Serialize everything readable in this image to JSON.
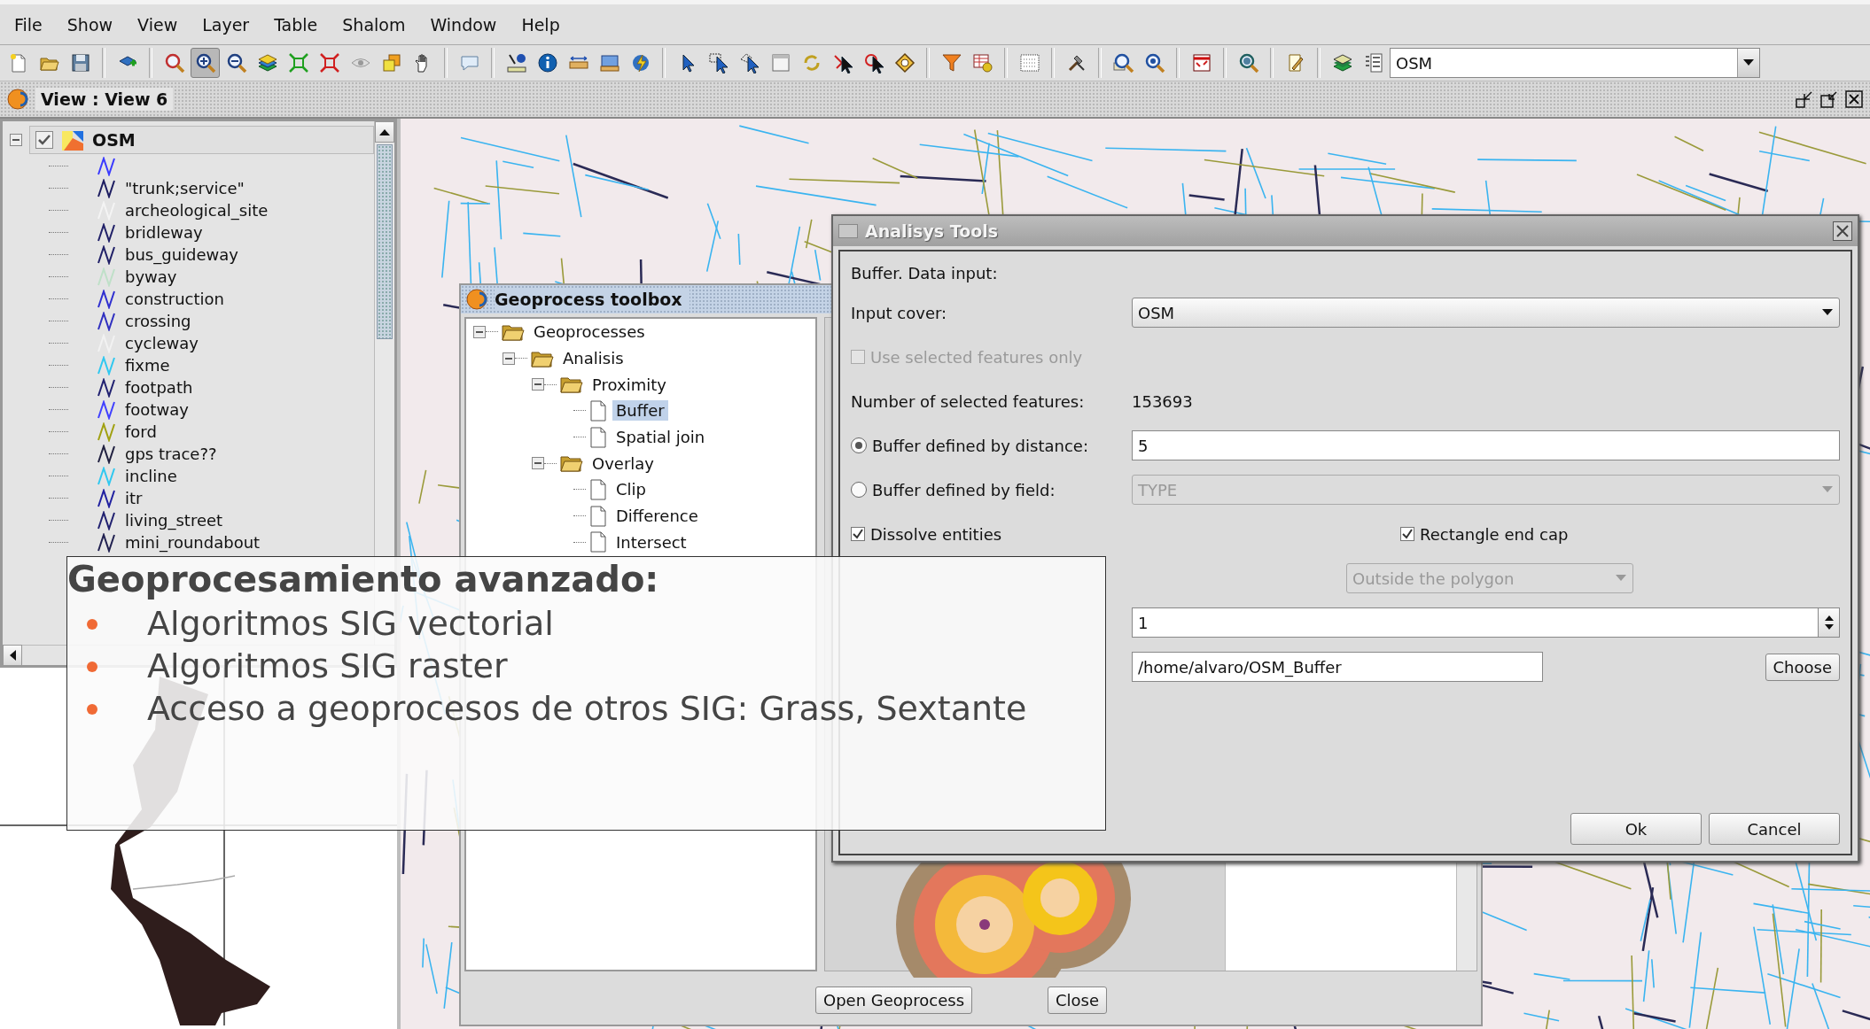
{
  "menu_bar": [
    "File",
    "Show",
    "View",
    "Layer",
    "Table",
    "Shalom",
    "Window",
    "Help"
  ],
  "toolbar": {
    "tools": [
      {
        "selected": false
      },
      {
        "selected": false
      },
      {
        "selected": false
      },
      {
        "selected": false
      },
      {
        "selected": false
      },
      {
        "selected": true
      },
      {
        "selected": false
      },
      {
        "selected": false
      },
      {
        "selected": false
      },
      {
        "selected": false
      },
      {
        "selected": false
      },
      {
        "selected": false
      },
      {
        "selected": false
      },
      {
        "selected": false
      },
      {
        "selected": false
      },
      {
        "selected": false
      },
      {
        "selected": false
      },
      {
        "selected": false
      },
      {
        "selected": false
      },
      {
        "selected": false
      },
      {
        "selected": false
      },
      {
        "selected": false
      },
      {
        "selected": false
      },
      {
        "selected": false
      },
      {
        "selected": false
      },
      {
        "selected": false
      },
      {
        "selected": false
      },
      {
        "selected": false
      },
      {
        "selected": false
      },
      {
        "selected": false
      },
      {
        "selected": false
      },
      {
        "selected": false
      },
      {
        "selected": false
      },
      {
        "selected": false
      },
      {
        "selected": false
      },
      {
        "selected": false
      },
      {
        "selected": false
      },
      {
        "selected": false
      }
    ],
    "layer_combo": "OSM"
  },
  "view_window": {
    "title": "View : View 6"
  },
  "layer_tree": {
    "root": {
      "label": "OSM",
      "checked": true,
      "expanded": true,
      "children": [
        {
          "color": "#3a3aff"
        },
        {
          "label": "\"trunk;service\"",
          "color": "#1c1c60"
        },
        {
          "label": "archeological_site",
          "color": "#f4f4f4"
        },
        {
          "label": "bridleway",
          "color": "#202068"
        },
        {
          "label": "bus_guideway",
          "color": "#202068"
        },
        {
          "label": "byway",
          "color": "#bfe0c8"
        },
        {
          "label": "construction",
          "color": "#2f2fd0"
        },
        {
          "label": "crossing",
          "color": "#2f2fc0"
        },
        {
          "label": "cycleway",
          "color": "#f2f2f2"
        },
        {
          "label": "fixme",
          "color": "#30c8f0"
        },
        {
          "label": "footpath",
          "color": "#202070"
        },
        {
          "label": "footway",
          "color": "#4040ff"
        },
        {
          "label": "ford",
          "color": "#a0a010"
        },
        {
          "label": "gps trace??",
          "color": "#202040"
        },
        {
          "label": "incline",
          "color": "#30c8f0"
        },
        {
          "label": "itr",
          "color": "#2020a0"
        },
        {
          "label": "living_street",
          "color": "#202070"
        },
        {
          "label": "mini_roundabout",
          "color": "#202050"
        }
      ]
    }
  },
  "geoprocess_toolbox": {
    "title": "Geoprocess toolbox",
    "tree": [
      {
        "label": "Geoprocesses",
        "kind": "folder",
        "expanded": true,
        "selected": false,
        "children": [
          {
            "label": "Analisis",
            "kind": "folder",
            "expanded": true,
            "selected": false,
            "children": [
              {
                "label": "Proximity",
                "kind": "folder",
                "expanded": true,
                "selected": false,
                "children": [
                  {
                    "label": "Buffer",
                    "kind": "file",
                    "selected": true
                  },
                  {
                    "label": "Spatial join",
                    "kind": "file",
                    "selected": false
                  }
                ]
              },
              {
                "label": "Overlay",
                "kind": "folder",
                "expanded": true,
                "selected": false,
                "children": [
                  {
                    "label": "Clip",
                    "kind": "file",
                    "selected": false
                  },
                  {
                    "label": "Difference",
                    "kind": "file",
                    "selected": false
                  },
                  {
                    "label": "Intersect",
                    "kind": "file",
                    "selected": false
                  }
                ]
              }
            ]
          }
        ]
      }
    ],
    "buttons": [
      "Open Geoprocess",
      "Close"
    ]
  },
  "analysis_dialog": {
    "title": "Analisys Tools",
    "heading": "Buffer. Data input:",
    "rows": [
      {
        "kind": "combo",
        "label": "Input cover:",
        "value": "OSM",
        "disabled": false
      },
      {
        "kind": "checkbox",
        "label": "Use selected features only",
        "checked": false,
        "disabled": true
      },
      {
        "kind": "info",
        "label": "Number of selected features:",
        "value": "153693"
      },
      {
        "kind": "radio",
        "label": "Buffer defined by distance:",
        "selected": true,
        "control": {
          "kind": "field",
          "value": "5"
        }
      },
      {
        "kind": "radio",
        "label": "Buffer defined by field:",
        "selected": false,
        "control": {
          "kind": "combo",
          "value": "TYPE",
          "disabled": true
        }
      },
      {
        "kind": "check_pair",
        "items": [
          {
            "label": "Dissolve entities",
            "checked": true
          },
          {
            "label": "Rectangle end cap",
            "checked": true
          }
        ]
      },
      {
        "kind": "option_combo",
        "value": "Outside the polygon",
        "disabled": true
      },
      {
        "kind": "spinner",
        "value": "1"
      },
      {
        "kind": "file",
        "value": "/home/alvaro/OSM_Buffer",
        "button": "Choose"
      }
    ],
    "buttons": [
      "Ok",
      "Cancel"
    ]
  },
  "slide_overlay": {
    "title": "Geoprocesamiento avanzado:",
    "bullets": [
      "Algoritmos SIG vectorial",
      "Algoritmos SIG raster",
      "Acceso a geoprocesos de otros SIG: Grass, Sextante"
    ]
  }
}
